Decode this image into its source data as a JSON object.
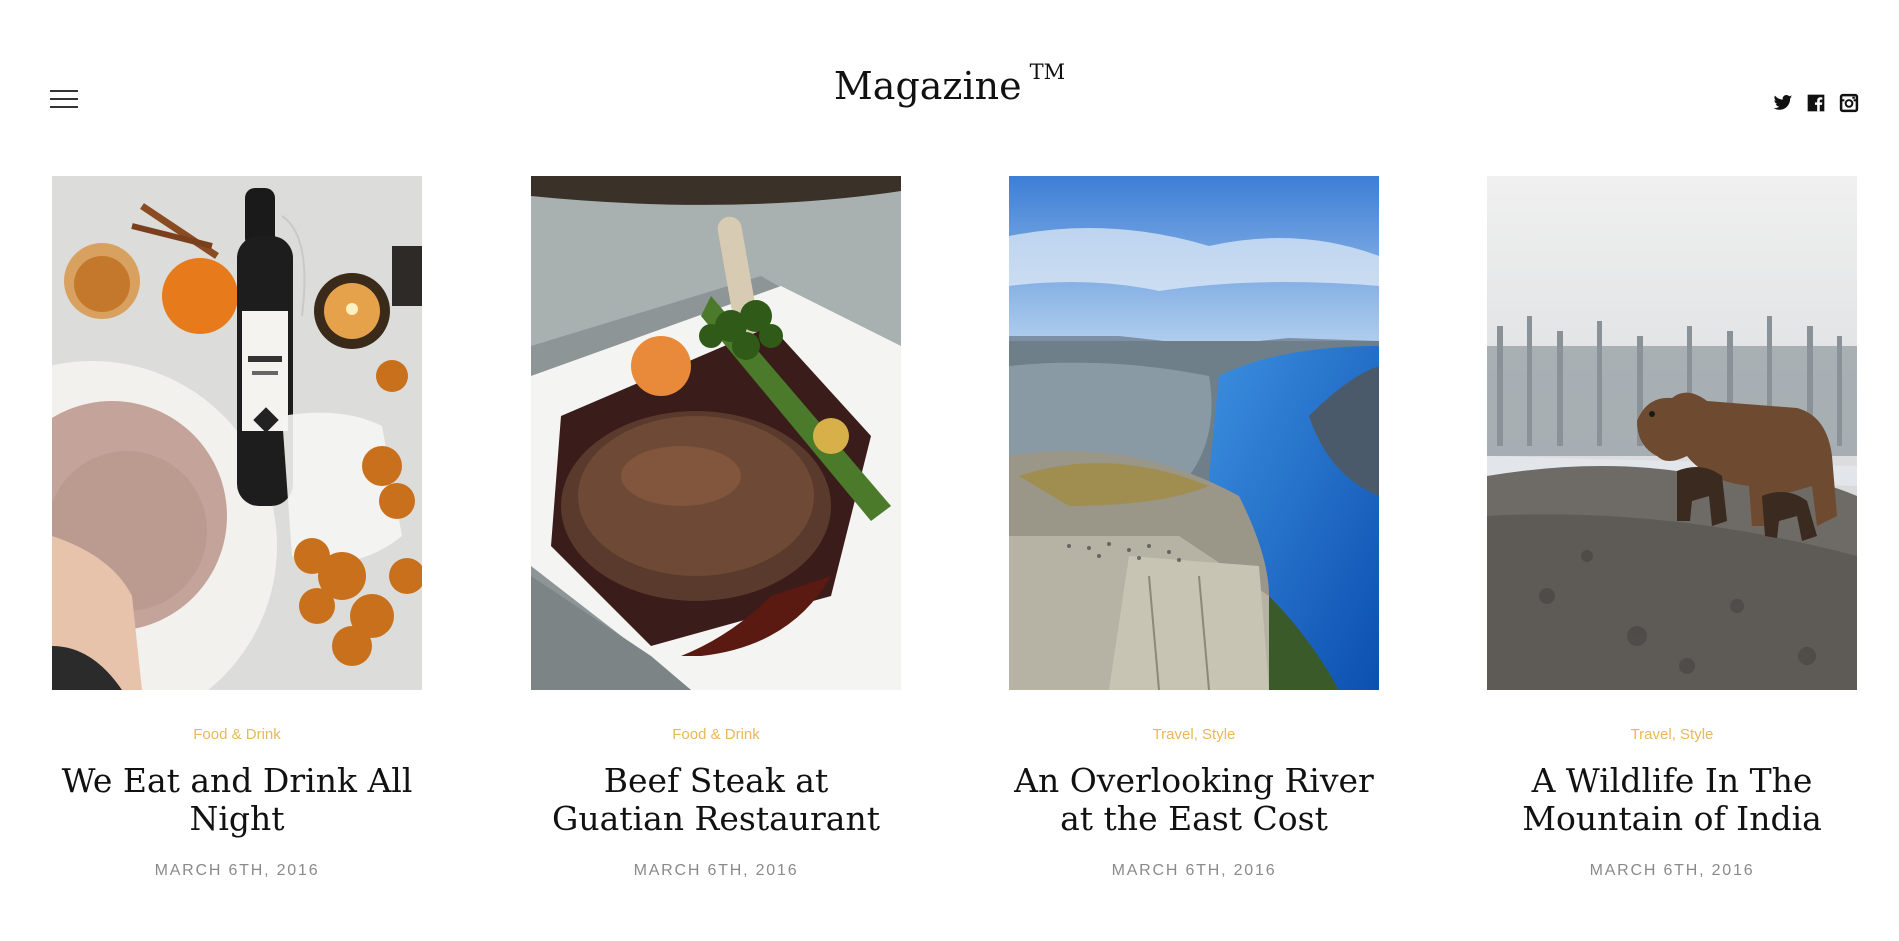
{
  "header": {
    "logo": "Magazine",
    "logo_mark": "TM",
    "menu_icon": "hamburger-menu-icon",
    "socials": [
      {
        "name": "twitter",
        "icon": "twitter-icon"
      },
      {
        "name": "facebook",
        "icon": "facebook-icon"
      },
      {
        "name": "instagram",
        "icon": "instagram-icon"
      }
    ]
  },
  "colors": {
    "category": "#e8b85a",
    "date": "#8a8a8a",
    "title": "#111111"
  },
  "posts": [
    {
      "categories": [
        "Food & Drink"
      ],
      "title": "We Eat and Drink All Night",
      "date": "MARCH 6TH, 2016",
      "image": "wine-and-food-photo"
    },
    {
      "categories": [
        "Food & Drink"
      ],
      "title": "Beef Steak at Guatian Restaurant",
      "date": "MARCH 6TH, 2016",
      "image": "steak-plate-photo"
    },
    {
      "categories": [
        "Travel",
        "Style"
      ],
      "title": "An Overlooking River at the East Cost",
      "date": "MARCH 6TH, 2016",
      "image": "fjord-cliff-photo"
    },
    {
      "categories": [
        "Travel",
        "Style"
      ],
      "title": "A Wildlife In The Mountain of India",
      "date": "MARCH 6TH, 2016",
      "image": "bear-mountain-photo"
    }
  ]
}
